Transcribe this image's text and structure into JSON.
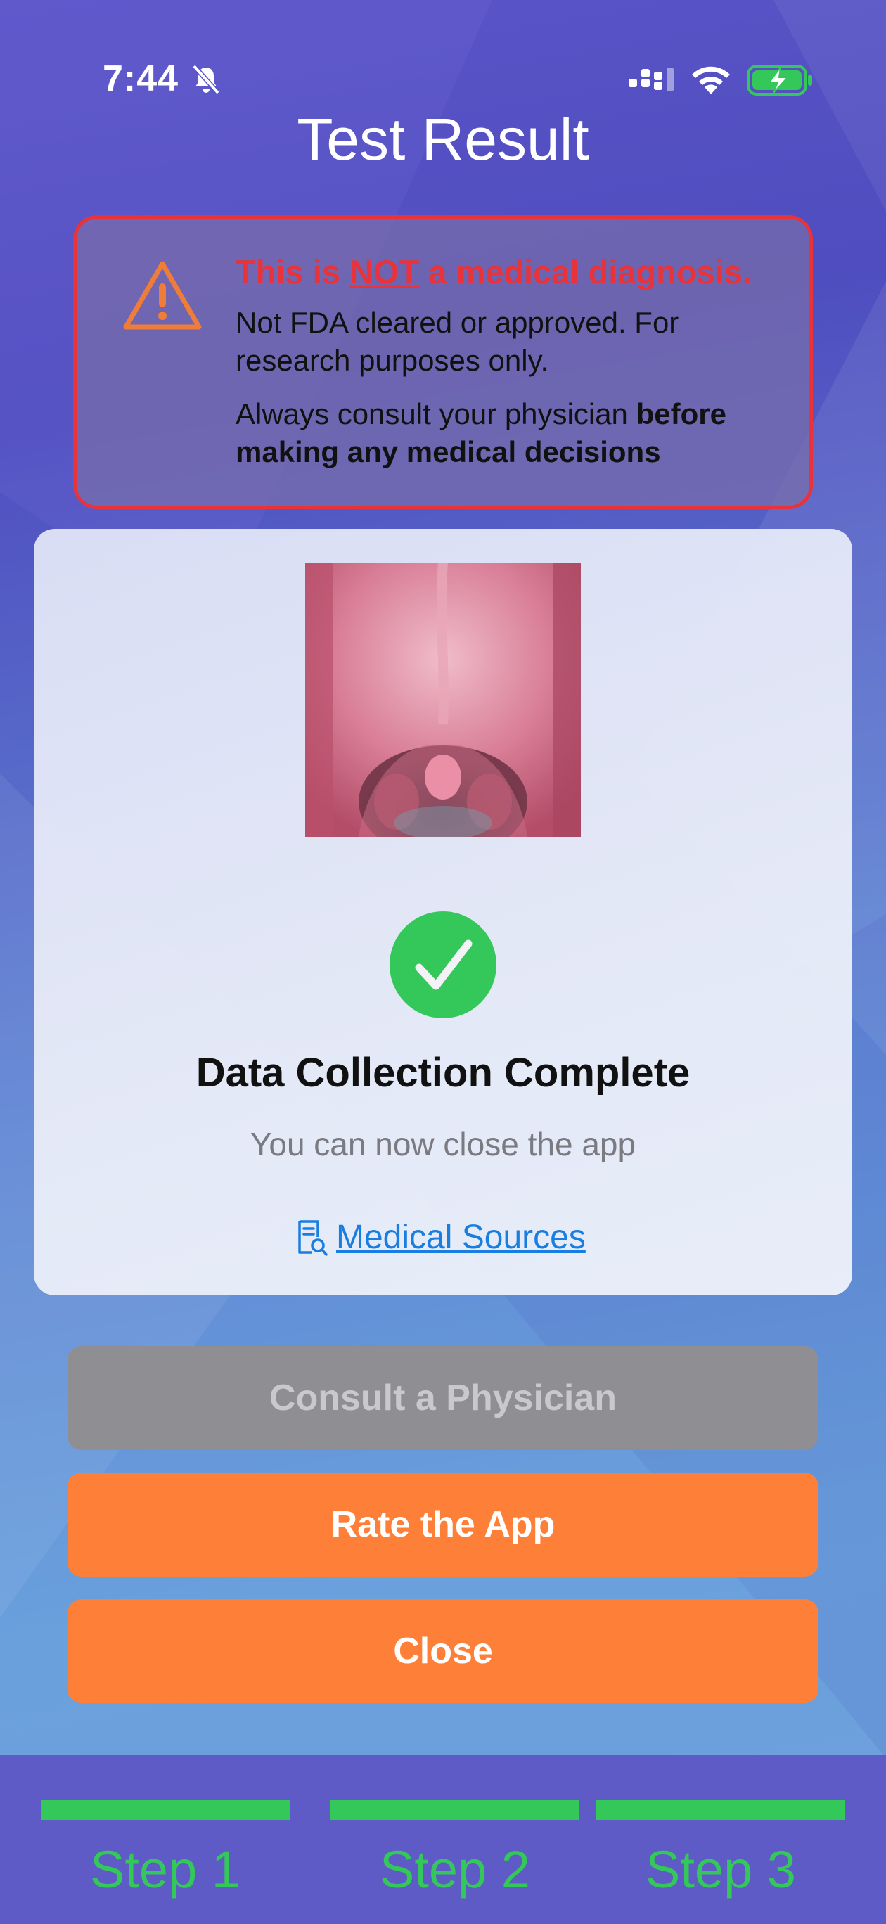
{
  "status_bar": {
    "time": "7:44",
    "icons": [
      "bell-slash-icon",
      "cellular-signal-icon",
      "wifi-icon",
      "battery-charging-icon"
    ]
  },
  "header": {
    "title": "Test Result"
  },
  "disclaimer": {
    "icon": "warning-triangle-icon",
    "heading_pre": "This is ",
    "heading_emph": "NOT",
    "heading_post": " a medical diagnosis.",
    "line1": "Not FDA cleared or approved. For research purposes only.",
    "line2_plain": "Always consult your physician ",
    "line2_bold": "before making any medical decisions",
    "colors": {
      "border": "#e8333b",
      "icon": "#f07c3a"
    }
  },
  "result_card": {
    "image": "throat-photo",
    "status_icon": "checkmark-circle-icon",
    "status_title": "Data Collection Complete",
    "status_subtitle": "You can now close the app",
    "sources_icon": "document-search-icon",
    "sources_link": "Medical Sources"
  },
  "actions": {
    "consult_label": "Consult a Physician",
    "rate_label": "Rate the App",
    "close_label": "Close"
  },
  "steps": [
    {
      "label": "Step 1",
      "complete": true
    },
    {
      "label": "Step 2",
      "complete": true
    },
    {
      "label": "Step 3",
      "complete": true
    }
  ],
  "colors": {
    "accent_orange": "#fe8038",
    "success_green": "#34c759",
    "link_blue": "#1a7de0",
    "disabled_gray": "#8e8e93"
  }
}
